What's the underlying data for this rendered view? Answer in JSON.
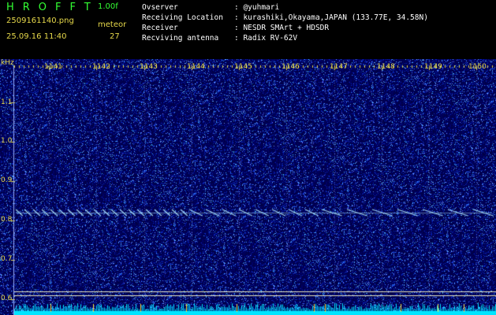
{
  "header": {
    "app_title": "HROFFT",
    "version": "1.00f",
    "filename": "2509161140.png",
    "datetime": "25.09.16 11:40",
    "meteor_label": "meteor",
    "meteor_count": "27"
  },
  "info": [
    {
      "label": "Ovserver",
      "value": ": @yuhmari"
    },
    {
      "label": "Receiving Location",
      "value": ": kurashiki,Okayama,JAPAN (133.77E, 34.58N)"
    },
    {
      "label": "Receiver",
      "value": ": NESDR SMArt + HDSDR"
    },
    {
      "label": "Recviving antenna",
      "value": ": Radix RV-62V"
    }
  ],
  "chart_data": {
    "type": "heatmap",
    "ylabel": "kHz",
    "y_ticks": [
      "1.1",
      "1.0",
      "0.9",
      "0.8",
      "0.7",
      "0.6"
    ],
    "x_ticks": [
      "1141",
      "1142",
      "1143",
      "1144",
      "1145",
      "1146",
      "1147",
      "1148",
      "1149",
      "1150"
    ],
    "signal_khz": 0.82,
    "colors": {
      "background": "#000050",
      "noise": "#3a5cff",
      "signal": "#aee8ff",
      "axis_text": "#e6d84a",
      "baseline": "#00e5ff"
    }
  }
}
